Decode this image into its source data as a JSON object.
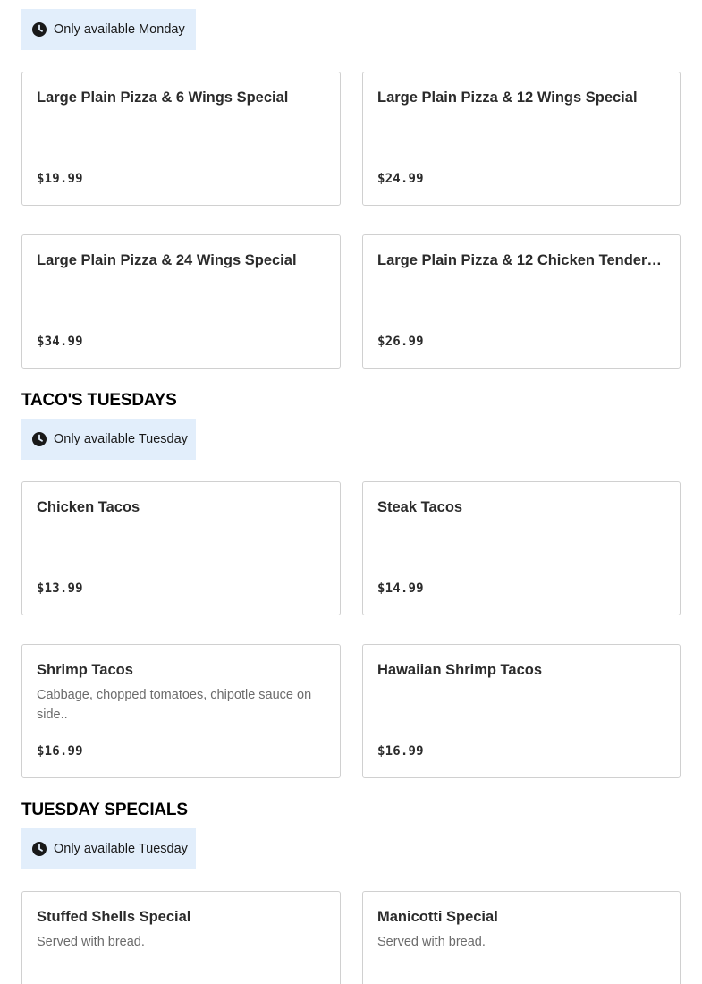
{
  "sections": [
    {
      "title": "",
      "availability": "Only available Monday",
      "items": [
        {
          "name": "Large Plain Pizza & 6 Wings Special",
          "description": "",
          "price": "$19.99"
        },
        {
          "name": "Large Plain Pizza & 12 Wings Special",
          "description": "",
          "price": "$24.99"
        },
        {
          "name": "Large Plain Pizza & 24 Wings Special",
          "description": "",
          "price": "$34.99"
        },
        {
          "name": "Large Plain Pizza & 12 Chicken Tenders...",
          "description": "",
          "price": "$26.99"
        }
      ]
    },
    {
      "title": "TACO'S TUESDAYS",
      "availability": "Only available Tuesday",
      "items": [
        {
          "name": "Chicken Tacos",
          "description": "",
          "price": "$13.99"
        },
        {
          "name": "Steak Tacos",
          "description": "",
          "price": "$14.99"
        },
        {
          "name": "Shrimp Tacos",
          "description": "Cabbage, chopped tomatoes, chipotle sauce on side..",
          "price": "$16.99"
        },
        {
          "name": "Hawaiian Shrimp Tacos",
          "description": "",
          "price": "$16.99"
        }
      ]
    },
    {
      "title": "TUESDAY SPECIALS",
      "availability": "Only available Tuesday",
      "items": [
        {
          "name": "Stuffed Shells Special",
          "description": "Served with bread.",
          "price": ""
        },
        {
          "name": "Manicotti Special",
          "description": "Served with bread.",
          "price": ""
        }
      ]
    }
  ],
  "icons": {
    "availability_icon": "clock-icon"
  },
  "colors": {
    "badge_background": "#e2eefb",
    "card_border": "#d0d0d0",
    "text_primary": "#191919",
    "text_secondary": "#6b6b6b"
  }
}
